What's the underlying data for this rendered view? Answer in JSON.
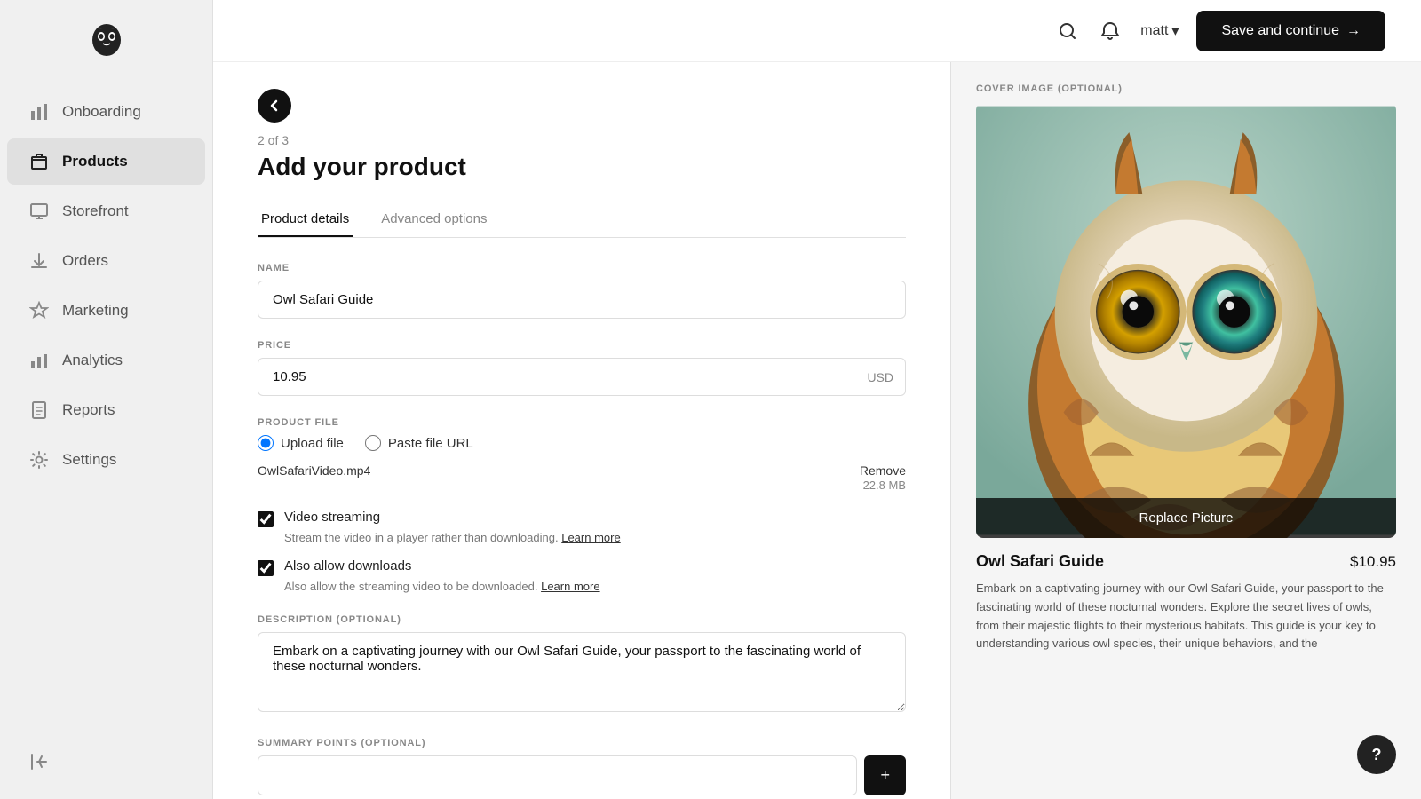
{
  "sidebar": {
    "items": [
      {
        "id": "onboarding",
        "label": "Onboarding",
        "icon": "chart-icon",
        "active": false
      },
      {
        "id": "products",
        "label": "Products",
        "icon": "box-icon",
        "active": true
      },
      {
        "id": "storefront",
        "label": "Storefront",
        "icon": "monitor-icon",
        "active": false
      },
      {
        "id": "orders",
        "label": "Orders",
        "icon": "download-icon",
        "active": false
      },
      {
        "id": "marketing",
        "label": "Marketing",
        "icon": "star-icon",
        "active": false
      },
      {
        "id": "analytics",
        "label": "Analytics",
        "icon": "bar-chart-icon",
        "active": false
      },
      {
        "id": "reports",
        "label": "Reports",
        "icon": "document-icon",
        "active": false
      },
      {
        "id": "settings",
        "label": "Settings",
        "icon": "gear-icon",
        "active": false
      }
    ],
    "bottom_item": {
      "label": "Exit",
      "icon": "exit-icon"
    }
  },
  "topbar": {
    "user_label": "matt",
    "save_button_label": "Save and continue",
    "save_button_arrow": "→"
  },
  "form": {
    "step_label": "2 of 3",
    "page_title": "Add your product",
    "tabs": [
      {
        "id": "product-details",
        "label": "Product details",
        "active": true
      },
      {
        "id": "advanced-options",
        "label": "Advanced options",
        "active": false
      }
    ],
    "name_label": "NAME",
    "name_value": "Owl Safari Guide",
    "name_placeholder": "",
    "price_label": "PRICE",
    "price_value": "10.95",
    "price_currency": "USD",
    "product_file_label": "PRODUCT FILE",
    "upload_file_label": "Upload file",
    "paste_url_label": "Paste file URL",
    "file_name": "OwlSafariVideo.mp4",
    "remove_label": "Remove",
    "file_size": "22.8 MB",
    "video_streaming_label": "Video streaming",
    "video_streaming_desc": "Stream the video in a player rather than downloading.",
    "video_streaming_link": "Learn more",
    "video_streaming_checked": true,
    "also_allow_downloads_label": "Also allow downloads",
    "also_allow_downloads_desc": "Also allow the streaming video to be downloaded.",
    "also_allow_downloads_link": "Learn more",
    "also_allow_downloads_checked": true,
    "description_label": "DESCRIPTION (OPTIONAL)",
    "description_value": "Embark on a captivating journey with our Owl Safari Guide, your passport to the fascinating world of these nocturnal wonders.",
    "summary_label": "SUMMARY POINTS (OPTIONAL)"
  },
  "preview": {
    "cover_image_label": "COVER IMAGE (OPTIONAL)",
    "replace_btn_label": "Replace Picture",
    "product_name": "Owl Safari Guide",
    "product_price": "$10.95",
    "product_desc": "Embark on a captivating journey with our Owl Safari Guide, your passport to the fascinating world of these nocturnal wonders. Explore the secret lives of owls, from their majestic flights to their mysterious habitats. This guide is your key to understanding various owl species, their unique behaviors, and the"
  },
  "help_button_label": "?"
}
